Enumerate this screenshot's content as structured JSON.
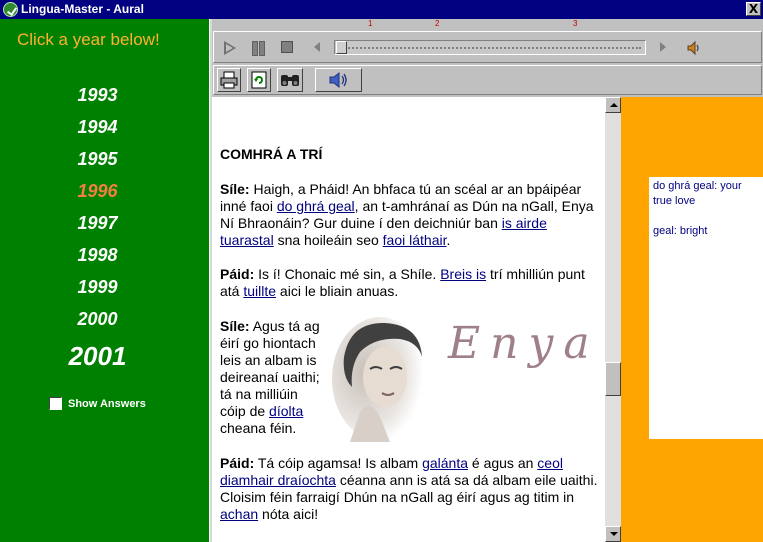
{
  "window": {
    "title": "Lingua-Master - Aural",
    "close_label": "X"
  },
  "left_panel": {
    "prompt": "Click a year below!",
    "years": [
      "1993",
      "1994",
      "1995",
      "1996",
      "1997",
      "1998",
      "1999",
      "2000",
      "2001"
    ],
    "selected_year": "1996",
    "show_answers_label": "Show Answers",
    "show_answers_checked": false
  },
  "player": {
    "markers": [
      "1",
      "2",
      "3"
    ],
    "progress": 0
  },
  "content": {
    "heading": "COMHRÁ A TRÍ",
    "p1": {
      "speaker": "Síle:",
      "t1": " Haigh, a Pháid! An bhfaca tú an scéal ar an bpáipéar inné faoi ",
      "l1": "do ghrá geal",
      "t2": ", an t-amhránaí as Dún na nGall, Enya Ní Bhraonáin? Gur duine í den deichniúr ban ",
      "l2": "is airde tuarastal",
      "t3": " sna hoileáin seo ",
      "l3": "faoi láthair",
      "t4": "."
    },
    "p2": {
      "speaker": "Páid:",
      "t1": " Is í! Chonaic mé sin, a Shíle. ",
      "l1": "Breis is",
      "t2": " trí mhilliún punt atá ",
      "l2": "tuillte",
      "t3": " aici le bliain anuas."
    },
    "p3": {
      "speaker": "Síle:",
      "t1": " Agus tá ag",
      "t2": "éirí go hiontach",
      "t3": "leis an albam is",
      "t4": "deireanaí uaithi;",
      "t5": "tá na milliúin",
      "t6": "cóip de ",
      "l1": "díolta",
      "t7": "cheana féin."
    },
    "p4": {
      "speaker": "Páid:",
      "t1": " Tá cóip agamsa! Is albam ",
      "l1": "galánta",
      "t2": " é agus an ",
      "l2": "ceol diamhair draíochta",
      "t3": " céanna ann is atá sa dá albam eile uaithi. Cloisim féin farraigí Dhún na nGall ag éirí agus ag titim in ",
      "l3": "achan",
      "t4": " nóta aici!"
    },
    "image_logo_text": "Enya"
  },
  "gloss": {
    "entry1": "do ghrá geal: your true love",
    "entry2": "geal: bright"
  },
  "colors": {
    "left_bg": "#008000",
    "gloss_bg": "#ffa500",
    "link": "#000080",
    "title_bar": "#000080"
  }
}
